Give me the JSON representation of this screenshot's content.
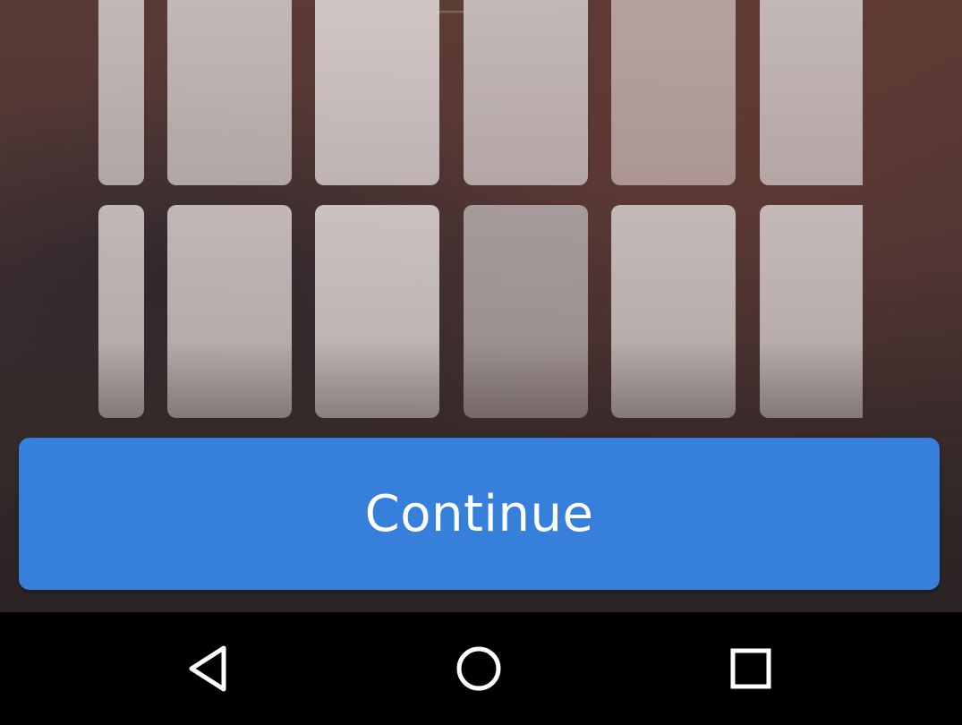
{
  "main": {
    "continue_label": "Continue"
  },
  "nav_bar": {
    "back_icon": "back-triangle-icon",
    "home_icon": "home-circle-icon",
    "recents_icon": "recents-square-icon"
  },
  "colors": {
    "button_blue": "#367fda",
    "nav_bar": "#000000"
  }
}
